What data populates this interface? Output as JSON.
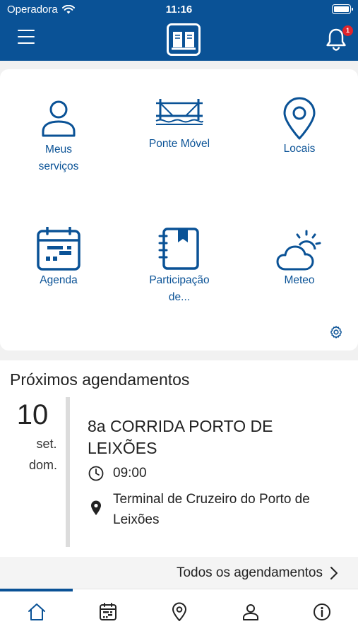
{
  "status_bar": {
    "carrier": "Operadora",
    "time": "11:16"
  },
  "header": {
    "notification_count": "1"
  },
  "tiles": [
    {
      "label_line1": "Meus",
      "label_line2": "serviços"
    },
    {
      "label_line1": "Ponte Móvel",
      "label_line2": ""
    },
    {
      "label_line1": "Locais",
      "label_line2": ""
    },
    {
      "label_line1": "Agenda",
      "label_line2": ""
    },
    {
      "label_line1": "Participação",
      "label_line2": "de..."
    },
    {
      "label_line1": "Meteo",
      "label_line2": ""
    }
  ],
  "next_events": {
    "title": "Próximos agendamentos",
    "event": {
      "day": "10",
      "month": "set.",
      "weekday": "dom.",
      "name": "8a CORRIDA PORTO DE LEIXÕES",
      "time": "09:00",
      "location": "Terminal de Cruzeiro do Porto de Leixões"
    },
    "all_label": "Todos os agendamentos"
  },
  "colors": {
    "brand_blue": "#0a5296",
    "badge_red": "#e0242b"
  }
}
